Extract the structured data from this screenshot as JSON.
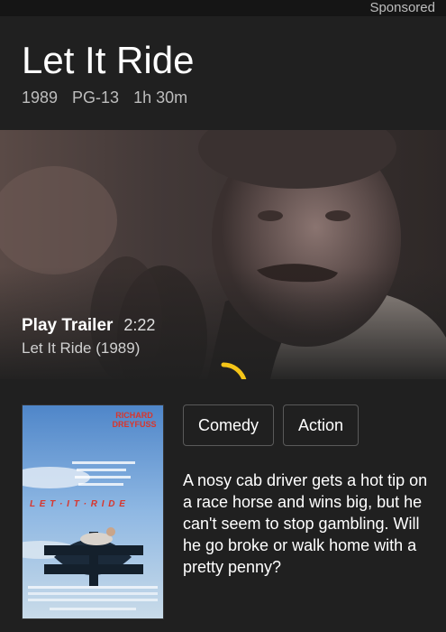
{
  "top_bar": {
    "sponsored_label": "Sponsored"
  },
  "movie": {
    "title": "Let It Ride",
    "year": "1989",
    "rating": "PG-13",
    "runtime": "1h 30m"
  },
  "trailer": {
    "label": "Play Trailer",
    "duration": "2:22",
    "subtitle": "Let It Ride (1989)",
    "loading_progress": 0.6
  },
  "poster": {
    "star_name": "RICHARD DREYFUSS",
    "title_art": "L E T · I T · R I D E"
  },
  "genres": [
    "Comedy",
    "Action"
  ],
  "description": "A nosy cab driver gets a hot tip on a race horse and wins big, but he can't seem to stop gambling. Will he go broke or walk home with a pretty penny?",
  "colors": {
    "background": "#202020",
    "spinner": "#f5c518",
    "chip_border": "#5a5a5a"
  },
  "icons": {
    "spinner": "loading-spinner-icon"
  }
}
